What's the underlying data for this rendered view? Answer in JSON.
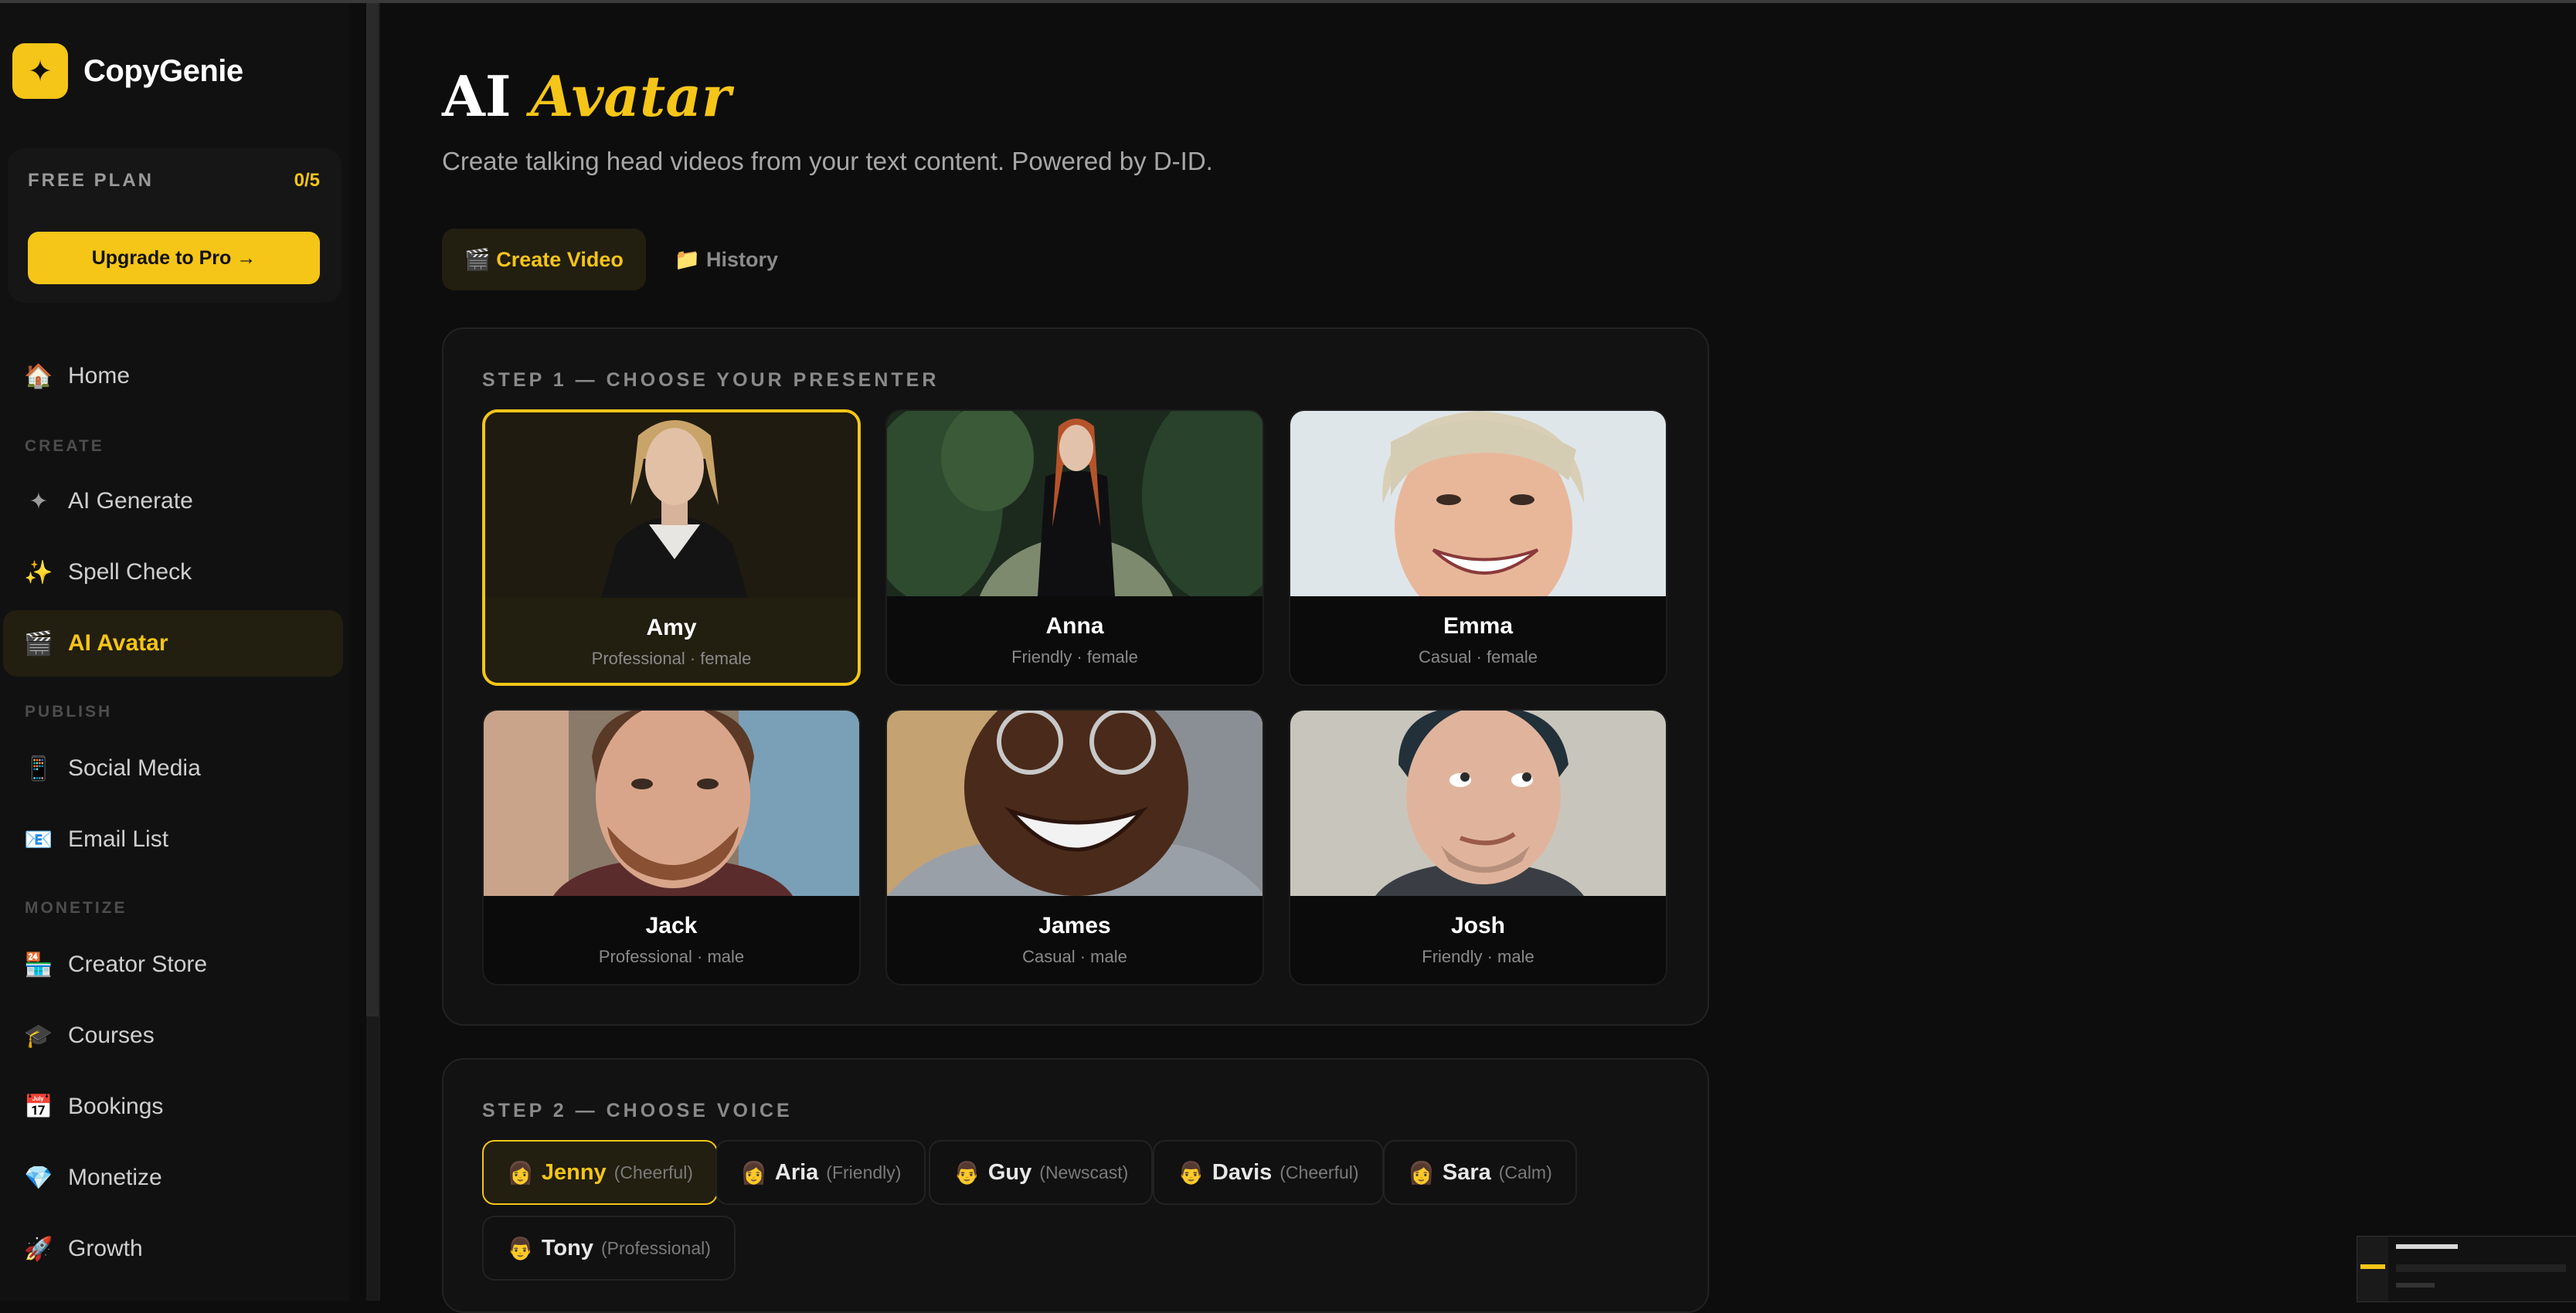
{
  "app": {
    "name": "CopyGenie",
    "logo_glyph": "✦"
  },
  "plan": {
    "label": "FREE PLAN",
    "count": "0/5",
    "upgrade_label": "Upgrade to Pro →"
  },
  "nav": {
    "home": {
      "icon": "🏠",
      "label": "Home"
    },
    "section_create": "CREATE",
    "ai_generate": {
      "icon": "✦",
      "label": "AI Generate"
    },
    "spell_check": {
      "icon": "✨",
      "label": "Spell Check"
    },
    "ai_avatar": {
      "icon": "🎬",
      "label": "AI Avatar"
    },
    "section_publish": "PUBLISH",
    "social_media": {
      "icon": "📱",
      "label": "Social Media"
    },
    "email_list": {
      "icon": "📧",
      "label": "Email List"
    },
    "section_monetize": "MONETIZE",
    "creator_store": {
      "icon": "🏪",
      "label": "Creator Store"
    },
    "courses": {
      "icon": "🎓",
      "label": "Courses"
    },
    "bookings": {
      "icon": "📅",
      "label": "Bookings"
    },
    "monetize": {
      "icon": "💎",
      "label": "Monetize"
    },
    "growth": {
      "icon": "🚀",
      "label": "Growth"
    }
  },
  "page": {
    "title_plain": "AI",
    "title_accent": "Avatar",
    "subtitle": "Create talking head videos from your text content. Powered by D-ID."
  },
  "tabs": {
    "create": "🎬 Create Video",
    "history": "📁 History"
  },
  "step1": {
    "label": "STEP 1 — CHOOSE YOUR PRESENTER",
    "presenters": [
      {
        "name": "Amy",
        "meta": "Professional · female"
      },
      {
        "name": "Anna",
        "meta": "Friendly · female"
      },
      {
        "name": "Emma",
        "meta": "Casual · female"
      },
      {
        "name": "Jack",
        "meta": "Professional · male"
      },
      {
        "name": "James",
        "meta": "Casual · male"
      },
      {
        "name": "Josh",
        "meta": "Friendly · male"
      }
    ]
  },
  "step2": {
    "label": "STEP 2 — CHOOSE VOICE",
    "voices": [
      {
        "icon": "👩",
        "name": "Jenny",
        "tone": "(Cheerful)"
      },
      {
        "icon": "👩",
        "name": "Aria",
        "tone": "(Friendly)"
      },
      {
        "icon": "👨",
        "name": "Guy",
        "tone": "(Newscast)"
      },
      {
        "icon": "👨",
        "name": "Davis",
        "tone": "(Cheerful)"
      },
      {
        "icon": "👩",
        "name": "Sara",
        "tone": "(Calm)"
      },
      {
        "icon": "👨",
        "name": "Tony",
        "tone": "(Professional)"
      }
    ]
  },
  "colors": {
    "accent": "#f5c518",
    "bg": "#0d0d0d",
    "sidebar": "#111111"
  }
}
